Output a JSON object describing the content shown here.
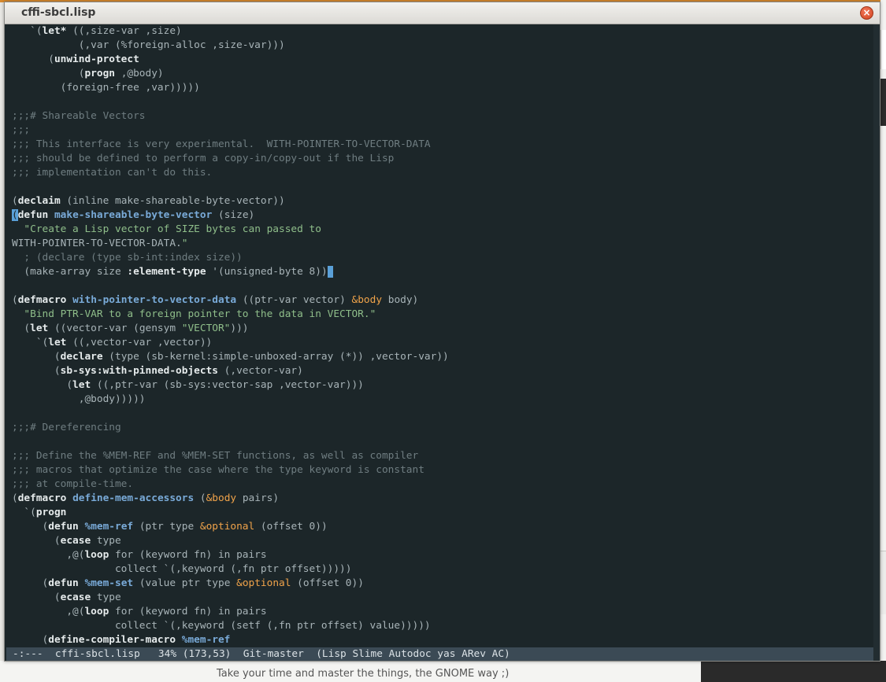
{
  "window": {
    "title": "cffi-sbcl.lisp",
    "close_glyph": "×"
  },
  "editor": {
    "lines": [
      "   `(let* ((,size-var ,size)",
      "           (,var (%foreign-alloc ,size-var)))",
      "      (unwind-protect",
      "           (progn ,@body)",
      "        (foreign-free ,var)))))",
      "",
      ";;;# Shareable Vectors",
      ";;;",
      ";;; This interface is very experimental.  WITH-POINTER-TO-VECTOR-DATA",
      ";;; should be defined to perform a copy-in/copy-out if the Lisp",
      ";;; implementation can't do this.",
      "",
      "(declaim (inline make-shareable-byte-vector))",
      "(defun make-shareable-byte-vector (size)",
      "  \"Create a Lisp vector of SIZE bytes can passed to",
      "WITH-POINTER-TO-VECTOR-DATA.\"",
      "  ; (declare (type sb-int:index size))",
      "  (make-array size :element-type '(unsigned-byte 8))",
      "",
      "(defmacro with-pointer-to-vector-data ((ptr-var vector) &body body)",
      "  \"Bind PTR-VAR to a foreign pointer to the data in VECTOR.\"",
      "  (let ((vector-var (gensym \"VECTOR\")))",
      "    `(let ((,vector-var ,vector))",
      "       (declare (type (sb-kernel:simple-unboxed-array (*)) ,vector-var))",
      "       (sb-sys:with-pinned-objects (,vector-var)",
      "         (let ((,ptr-var (sb-sys:vector-sap ,vector-var)))",
      "           ,@body)))))",
      "",
      ";;;# Dereferencing",
      "",
      ";;; Define the %MEM-REF and %MEM-SET functions, as well as compiler",
      ";;; macros that optimize the case where the type keyword is constant",
      ";;; at compile-time.",
      "(defmacro define-mem-accessors (&body pairs)",
      "  `(progn",
      "     (defun %mem-ref (ptr type &optional (offset 0))",
      "       (ecase type",
      "         ,@(loop for (keyword fn) in pairs",
      "                 collect `(,keyword (,fn ptr offset)))))",
      "     (defun %mem-set (value ptr type &optional (offset 0))",
      "       (ecase type",
      "         ,@(loop for (keyword fn) in pairs",
      "                 collect `(,keyword (setf (,fn ptr offset) value)))))",
      "     (define-compiler-macro %mem-ref"
    ]
  },
  "modeline": {
    "text": "-:---  cffi-sbcl.lisp   34% (173,53)  Git-master  (Lisp Slime Autodoc yas ARev AC)"
  },
  "desktop": {
    "bottom_message": "Take your time and master the things, the GNOME way ;)"
  },
  "colors": {
    "editor_bg": "#1c2629",
    "keyword": "#e6ebec",
    "function_name": "#79aad8",
    "string": "#8fbe8a",
    "comment": "#6f7d81",
    "lambda_keyword": "#f0a34a",
    "modeline_bg": "#3b4a55",
    "cursor": "#5aa0d8"
  }
}
